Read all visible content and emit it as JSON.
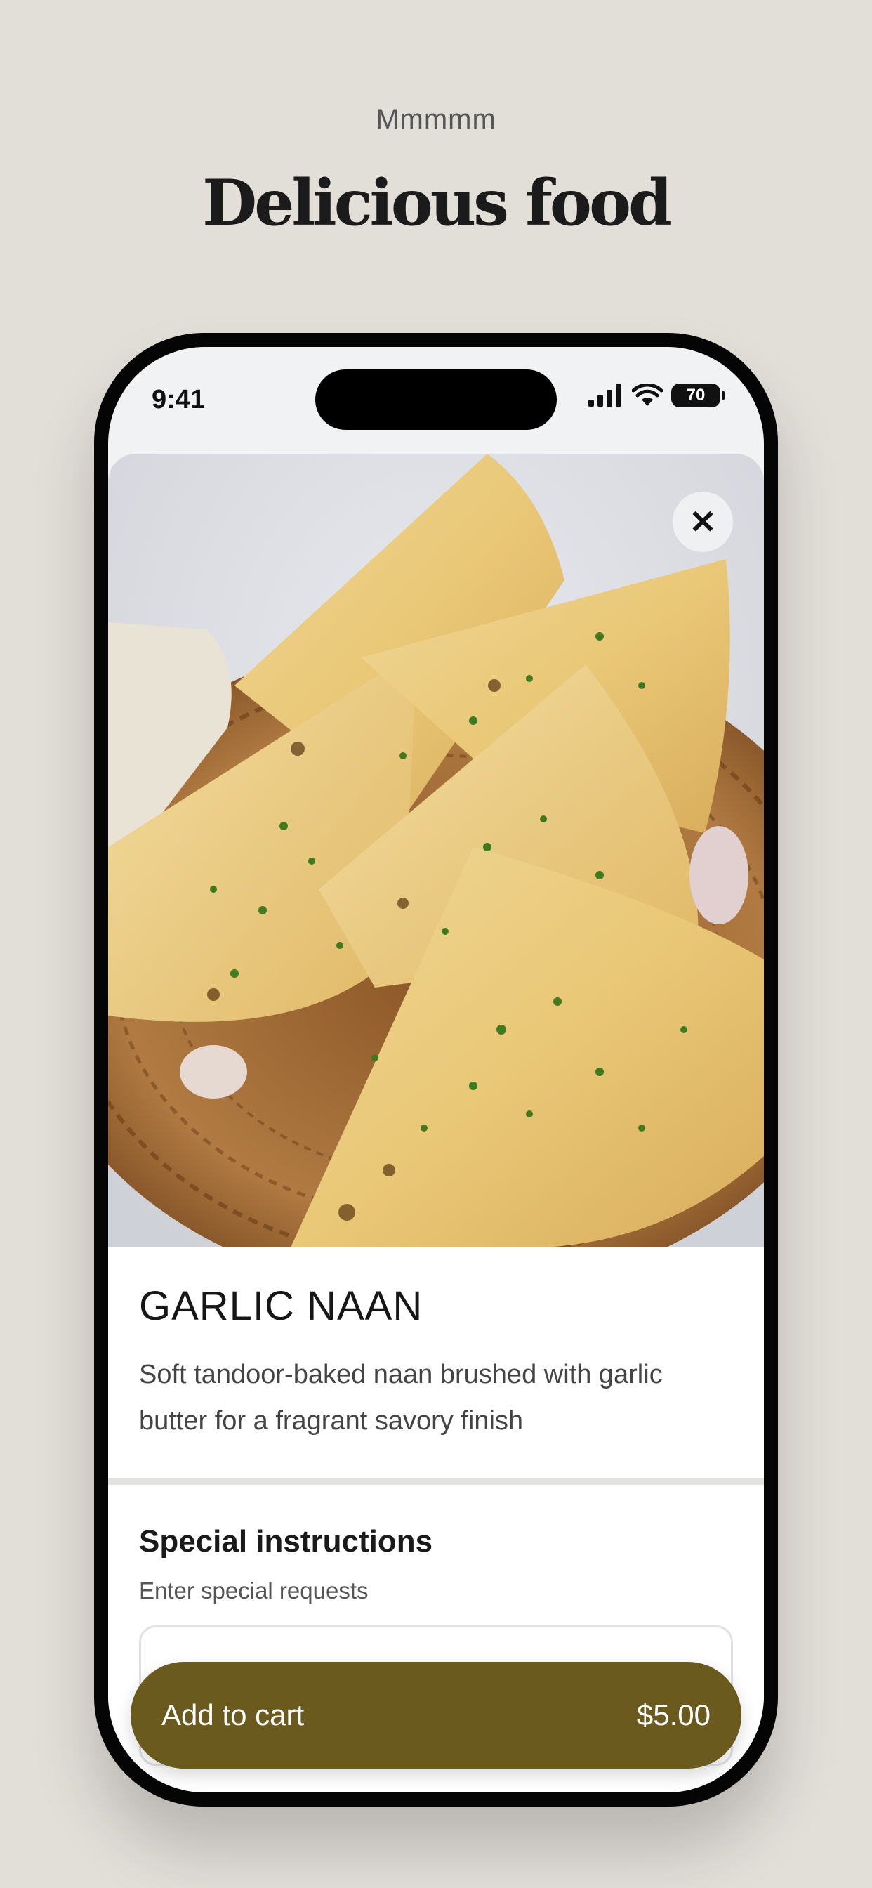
{
  "promo": {
    "kicker": "Mmmmm",
    "headline": "Delicious food"
  },
  "status_bar": {
    "time": "9:41",
    "battery": "70"
  },
  "item": {
    "image": "garlic naan in wicker basket",
    "title": "GARLIC NAAN",
    "description": "Soft tandoor-baked naan brushed with garlic butter for a fragrant savory finish"
  },
  "instructions": {
    "title": "Special instructions",
    "subtitle": "Enter special requests",
    "value": ""
  },
  "cart": {
    "label": "Add to cart",
    "price": "$5.00"
  },
  "colors": {
    "accent": "#6b5a1e",
    "background": "#e2dfd9"
  }
}
